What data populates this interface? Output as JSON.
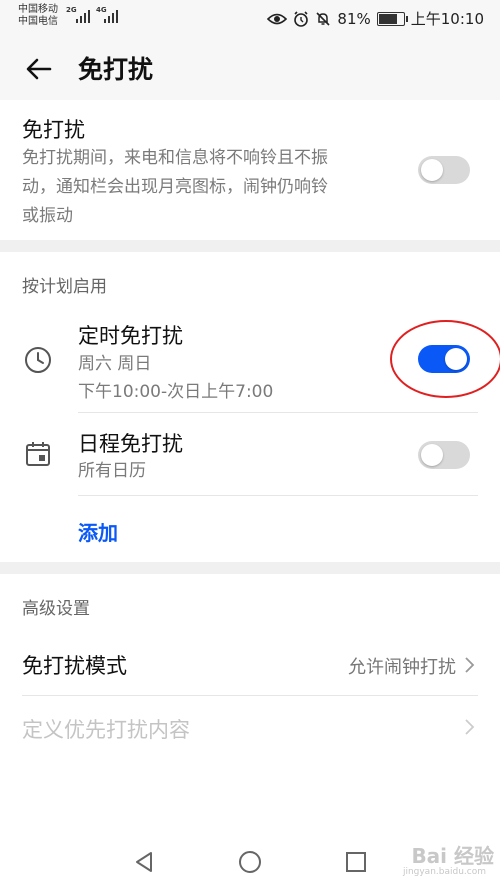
{
  "status": {
    "carrier1": "中国移动",
    "carrier2": "中国电信",
    "net1": "2G",
    "net2": "4G",
    "battery": "81%",
    "battery_level": 0.81,
    "time": "上午10:10"
  },
  "header": {
    "title": "免打扰"
  },
  "dnd": {
    "title": "免打扰",
    "description_lines": [
      "免打扰期间，来电和信息将不响铃且不振",
      "动，通知栏会出现月亮图标，闹钟仍响铃",
      "或振动"
    ],
    "enabled": false
  },
  "schedule": {
    "heading": "按计划启用",
    "timed": {
      "title": "定时免打扰",
      "days": "周六 周日",
      "time": "下午10:00-次日上午7:00",
      "enabled": true
    },
    "calendar": {
      "title": "日程免打扰",
      "subtitle": "所有日历",
      "enabled": false
    },
    "add_label": "添加"
  },
  "advanced": {
    "heading": "高级设置",
    "mode": {
      "label": "免打扰模式",
      "value": "允许闹钟打扰"
    },
    "priority": {
      "label": "定义优先打扰内容"
    }
  },
  "watermark": {
    "text": "Bai 经验",
    "sub": "jingyan.baidu.com"
  },
  "colors": {
    "accent": "#0a59f7",
    "highlight": "#e02020"
  },
  "icons": [
    "back-arrow-icon",
    "clock-icon",
    "calendar-icon",
    "chevron-right-icon",
    "nav-back-icon",
    "nav-home-icon",
    "nav-recent-icon"
  ]
}
